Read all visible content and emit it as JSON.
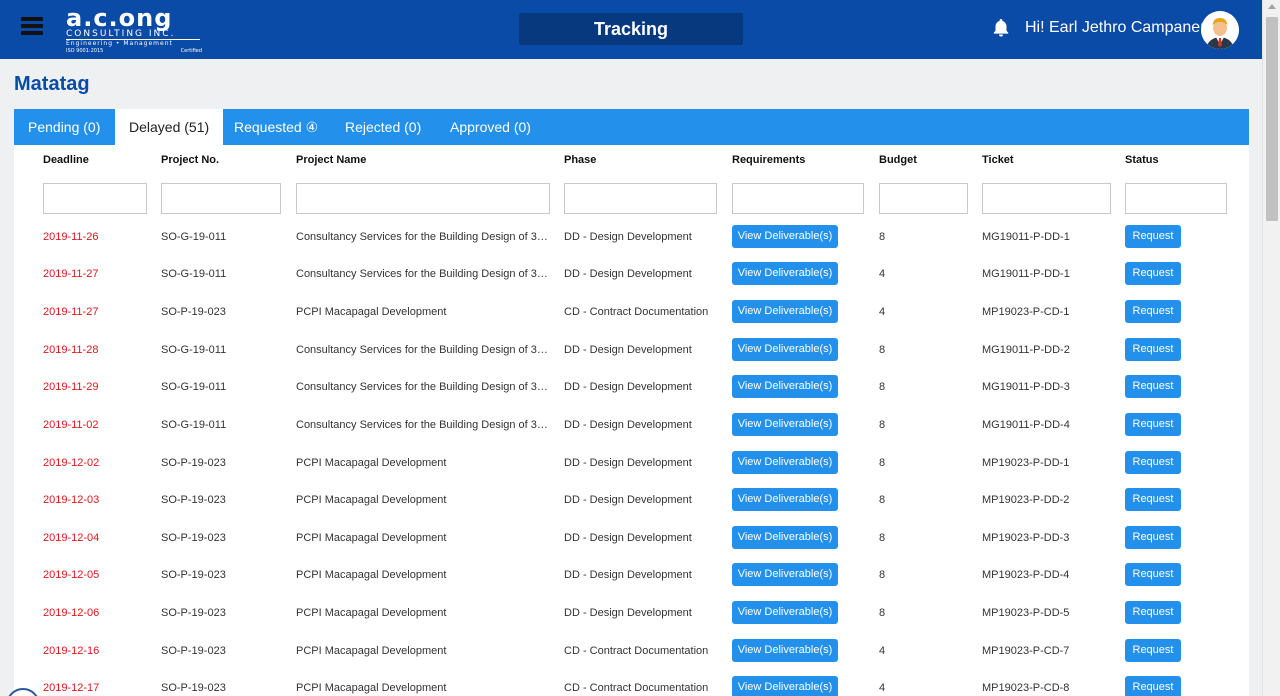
{
  "header": {
    "logo": {
      "line1": "a.c.ong",
      "line2": "CONSULTING INC.",
      "line3": "Engineering • Management",
      "line4_left": "ISO 9001:2015",
      "line4_right": "Certified"
    },
    "page_title": "Tracking",
    "greeting": "Hi! Earl Jethro Campaner",
    "icons": {
      "menu": "hamburger-menu-icon",
      "bell": "bell-icon",
      "avatar": "user-avatar"
    }
  },
  "page": {
    "heading": "Matatag"
  },
  "tabs": [
    {
      "label": "Pending (0)"
    },
    {
      "label": "Delayed (51)",
      "active": true
    },
    {
      "label": "Requested ④"
    },
    {
      "label": "Rejected (0)"
    },
    {
      "label": "Approved (0)"
    }
  ],
  "table": {
    "columns": [
      "Deadline",
      "Project No.",
      "Project Name",
      "Phase",
      "Requirements",
      "Budget",
      "Ticket",
      "Status"
    ],
    "view_label": "View Deliverable(s)",
    "request_label": "Request",
    "rows": [
      {
        "deadline": "2019-11-26",
        "project_no": "SO-G-19-011",
        "project_name": "Consultancy Services for the Building Design of 3-Storey",
        "phase": "DD - Design Development",
        "budget": "8",
        "ticket": "MG19011-P-DD-1"
      },
      {
        "deadline": "2019-11-27",
        "project_no": "SO-G-19-011",
        "project_name": "Consultancy Services for the Building Design of 3-Storey",
        "phase": "DD - Design Development",
        "budget": "4",
        "ticket": "MG19011-P-DD-1"
      },
      {
        "deadline": "2019-11-27",
        "project_no": "SO-P-19-023",
        "project_name": "PCPI Macapagal Development",
        "phase": "CD - Contract Documentation",
        "budget": "4",
        "ticket": "MP19023-P-CD-1"
      },
      {
        "deadline": "2019-11-28",
        "project_no": "SO-G-19-011",
        "project_name": "Consultancy Services for the Building Design of 3-Storey",
        "phase": "DD - Design Development",
        "budget": "8",
        "ticket": "MG19011-P-DD-2"
      },
      {
        "deadline": "2019-11-29",
        "project_no": "SO-G-19-011",
        "project_name": "Consultancy Services for the Building Design of 3-Storey",
        "phase": "DD - Design Development",
        "budget": "8",
        "ticket": "MG19011-P-DD-3"
      },
      {
        "deadline": "2019-11-02",
        "project_no": "SO-G-19-011",
        "project_name": "Consultancy Services for the Building Design of 3-Storey",
        "phase": "DD - Design Development",
        "budget": "8",
        "ticket": "MG19011-P-DD-4"
      },
      {
        "deadline": "2019-12-02",
        "project_no": "SO-P-19-023",
        "project_name": "PCPI Macapagal Development",
        "phase": "DD - Design Development",
        "budget": "8",
        "ticket": "MP19023-P-DD-1"
      },
      {
        "deadline": "2019-12-03",
        "project_no": "SO-P-19-023",
        "project_name": "PCPI Macapagal Development",
        "phase": "DD - Design Development",
        "budget": "8",
        "ticket": "MP19023-P-DD-2"
      },
      {
        "deadline": "2019-12-04",
        "project_no": "SO-P-19-023",
        "project_name": "PCPI Macapagal Development",
        "phase": "DD - Design Development",
        "budget": "8",
        "ticket": "MP19023-P-DD-3"
      },
      {
        "deadline": "2019-12-05",
        "project_no": "SO-P-19-023",
        "project_name": "PCPI Macapagal Development",
        "phase": "DD - Design Development",
        "budget": "8",
        "ticket": "MP19023-P-DD-4"
      },
      {
        "deadline": "2019-12-06",
        "project_no": "SO-P-19-023",
        "project_name": "PCPI Macapagal Development",
        "phase": "DD - Design Development",
        "budget": "8",
        "ticket": "MP19023-P-DD-5"
      },
      {
        "deadline": "2019-12-16",
        "project_no": "SO-P-19-023",
        "project_name": "PCPI Macapagal Development",
        "phase": "CD - Contract Documentation",
        "budget": "4",
        "ticket": "MP19023-P-CD-7"
      },
      {
        "deadline": "2019-12-17",
        "project_no": "SO-P-19-023",
        "project_name": "PCPI Macapagal Development",
        "phase": "CD - Contract Documentation",
        "budget": "4",
        "ticket": "MP19023-P-CD-8"
      }
    ]
  },
  "colors": {
    "header_bg": "#0a4ba8",
    "tab_bar": "#2390ec",
    "button": "#2390ec",
    "deadline": "#e0161c",
    "title": "#0a4ba8"
  }
}
